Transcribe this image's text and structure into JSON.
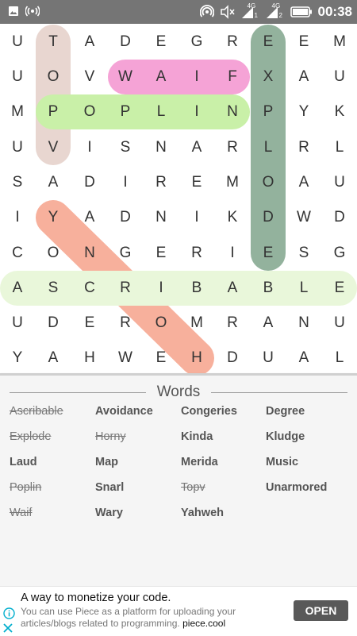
{
  "status_bar": {
    "time": "00:38",
    "left_icons": [
      "image-icon",
      "broadcast-icon"
    ],
    "right_icons": [
      "hotspot-icon",
      "mute-icon",
      "signal-1-icon",
      "signal-2-icon",
      "battery-icon"
    ],
    "signal_labels": [
      "4G",
      "4G",
      "1",
      "2"
    ]
  },
  "grid": {
    "rows": [
      "UTADEGREEM",
      "UOVWAIFXAU",
      "MPOPLINPYK",
      "UVISNARLRL",
      "SADIREMOAU",
      "IYADNIKDWD",
      "CONGERIESG",
      "ASCRIBABLE",
      "UDEROMRANU",
      "YAHWEHDUAL"
    ],
    "highlights": [
      {
        "word": "Topv",
        "color": "#e8d6d0",
        "from": [
          0,
          1
        ],
        "to": [
          3,
          1
        ]
      },
      {
        "word": "Waif",
        "color": "#f5a3d6",
        "from": [
          1,
          3
        ],
        "to": [
          1,
          6
        ]
      },
      {
        "word": "Poplin",
        "color": "#c9f0a8",
        "from": [
          2,
          1
        ],
        "to": [
          2,
          6
        ]
      },
      {
        "word": "Explode",
        "color": "#93b29d",
        "from": [
          0,
          7
        ],
        "to": [
          6,
          7
        ]
      },
      {
        "word": "Horny",
        "color": "#f7b09c",
        "from": [
          5,
          1
        ],
        "to": [
          9,
          5
        ]
      },
      {
        "word": "Ascribable",
        "color": "#e9f7da",
        "from": [
          7,
          0
        ],
        "to": [
          7,
          9
        ]
      }
    ]
  },
  "words_panel": {
    "title": "Words",
    "words": [
      {
        "text": "Ascribable",
        "found": true
      },
      {
        "text": "Avoidance",
        "found": false
      },
      {
        "text": "Congeries",
        "found": false
      },
      {
        "text": "Degree",
        "found": false
      },
      {
        "text": "Explode",
        "found": true
      },
      {
        "text": "Horny",
        "found": true
      },
      {
        "text": "Kinda",
        "found": false
      },
      {
        "text": "Kludge",
        "found": false
      },
      {
        "text": "Laud",
        "found": false
      },
      {
        "text": "Map",
        "found": false
      },
      {
        "text": "Merida",
        "found": false
      },
      {
        "text": "Music",
        "found": false
      },
      {
        "text": "Poplin",
        "found": true
      },
      {
        "text": "Snarl",
        "found": false
      },
      {
        "text": "Topv",
        "found": true
      },
      {
        "text": "Unarmored",
        "found": false
      },
      {
        "text": "Waif",
        "found": true
      },
      {
        "text": "Wary",
        "found": false
      },
      {
        "text": "Yahweh",
        "found": false
      }
    ]
  },
  "ad": {
    "headline": "A way to monetize your code.",
    "body": "You can use Piece as a platform for uploading your articles/blogs related to programming.",
    "domain": "piece.cool",
    "cta": "OPEN",
    "info_icon": "info-icon",
    "close_icon": "close-icon"
  }
}
